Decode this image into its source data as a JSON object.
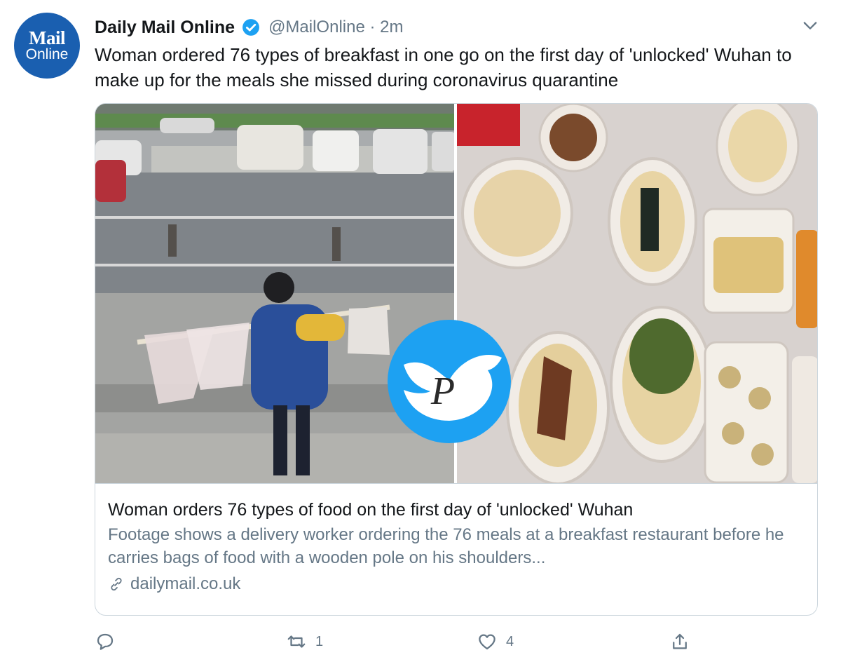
{
  "account": {
    "avatar_line1": "Mail",
    "avatar_line2": "Online",
    "name": "Daily Mail Online",
    "handle_time": "@MailOnline · 2m"
  },
  "tweet": {
    "text": "Woman ordered 76 types of breakfast in one go on the first day of 'unlocked' Wuhan to make up for the meals she missed during coronavirus quarantine"
  },
  "card": {
    "title": "Woman orders 76 types of food on the first day of 'unlocked' Wuhan",
    "description": "Footage shows a delivery worker ordering the 76 meals at a breakfast restaurant before he carries bags of food with a wooden pole on his shoulders...",
    "domain": "dailymail.co.uk",
    "watermark_letter": "P"
  },
  "actions": {
    "reply_count": "",
    "retweet_count": "1",
    "like_count": "4"
  },
  "icons": [
    "verified-badge-icon",
    "chevron-down-icon",
    "link-icon",
    "reply-icon",
    "retweet-icon",
    "like-icon",
    "share-icon",
    "bird-watermark-icon"
  ],
  "colors": {
    "brand_blue": "#1da1f2",
    "avatar_blue": "#1a5fb0",
    "secondary_text": "#657786",
    "border": "#ccd6dd"
  }
}
